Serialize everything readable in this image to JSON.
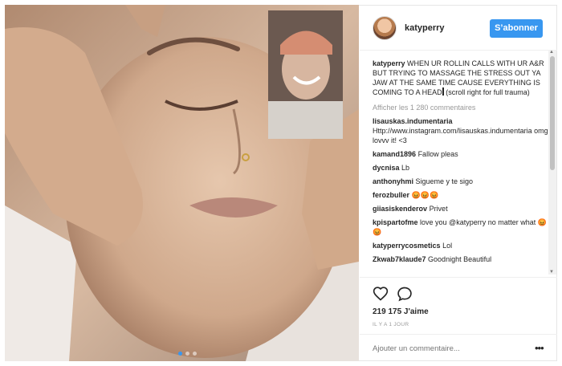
{
  "header": {
    "username": "katyperry",
    "follow_label": "S’abonner"
  },
  "caption": {
    "username": "katyperry",
    "text": "WHEN UR ROLLIN CALLS WITH UR A&R BUT TRYING TO MASSAGE THE STRESS OUT YA JAW AT THE SAME TIME CAUSE EVERYTHING IS COMING TO A HEAD",
    "suffix": "(scroll right for full trauma)"
  },
  "view_all_label": "Afficher les 1 280 commentaires",
  "comments": [
    {
      "user": "lisauskas.indumentaria",
      "text": "Http://www.instagram.com/lisauskas.indumentaria omg lovvv it! <3"
    },
    {
      "user": "kamand1896",
      "text": "Fallow pleas"
    },
    {
      "user": "dycnisa",
      "text": "Lb"
    },
    {
      "user": "anthonyhmi",
      "text": "Sigueme y te sigo"
    },
    {
      "user": "ferozbuller",
      "text": "😡😡😡"
    },
    {
      "user": "giiasiskenderov",
      "text": "Privet"
    },
    {
      "user": "kpispartofme",
      "text": "love you @katyperry no matter what 😡😡"
    },
    {
      "user": "katyperrycosmetics",
      "text": "Lol"
    },
    {
      "user": "Zkwab7klaude7",
      "text": "Goodnight Beautiful"
    }
  ],
  "actions": {
    "likes": "219 175 J'aime",
    "timestamp": "IL Y A 1 JOUR"
  },
  "add_comment": {
    "placeholder": "Ajouter un commentaire..."
  },
  "colors": {
    "accent": "#3897f0",
    "text": "#262626",
    "muted": "#999999"
  },
  "icons": [
    "heart-icon",
    "comment-bubble-icon",
    "more-icon",
    "avatar"
  ]
}
